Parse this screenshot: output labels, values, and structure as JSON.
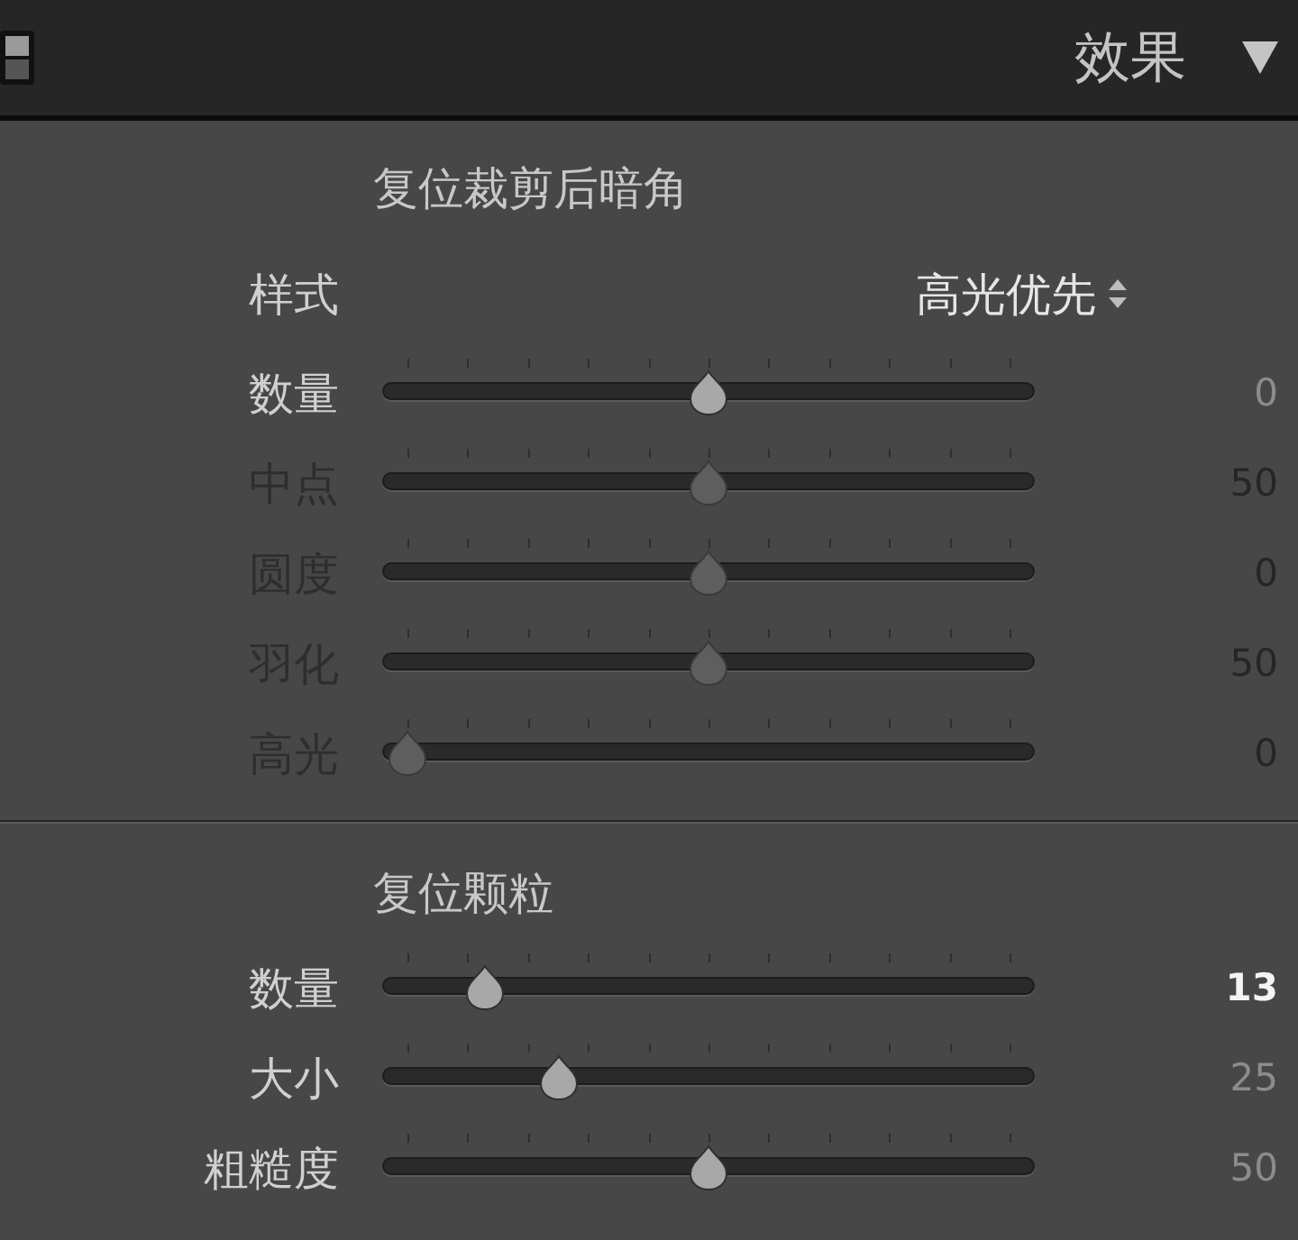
{
  "header": {
    "title": "效果"
  },
  "vignette": {
    "title": "复位裁剪后暗角",
    "style": {
      "label": "样式",
      "value": "高光优先"
    },
    "sliders": [
      {
        "label": "数量",
        "value": "0",
        "level": 0.5,
        "disabled": false,
        "active": false
      },
      {
        "label": "中点",
        "value": "50",
        "level": 0.5,
        "disabled": true,
        "active": false
      },
      {
        "label": "圆度",
        "value": "0",
        "level": 0.5,
        "disabled": true,
        "active": false
      },
      {
        "label": "羽化",
        "value": "50",
        "level": 0.5,
        "disabled": true,
        "active": false
      },
      {
        "label": "高光",
        "value": "0",
        "level": 0,
        "disabled": true,
        "active": false
      }
    ]
  },
  "grain": {
    "title": "复位颗粒",
    "sliders": [
      {
        "label": "数量",
        "value": "13",
        "level": 0.13,
        "disabled": false,
        "active": true
      },
      {
        "label": "大小",
        "value": "25",
        "level": 0.25,
        "disabled": false,
        "active": false
      },
      {
        "label": "粗糙度",
        "value": "50",
        "level": 0.5,
        "disabled": false,
        "active": false
      }
    ]
  }
}
